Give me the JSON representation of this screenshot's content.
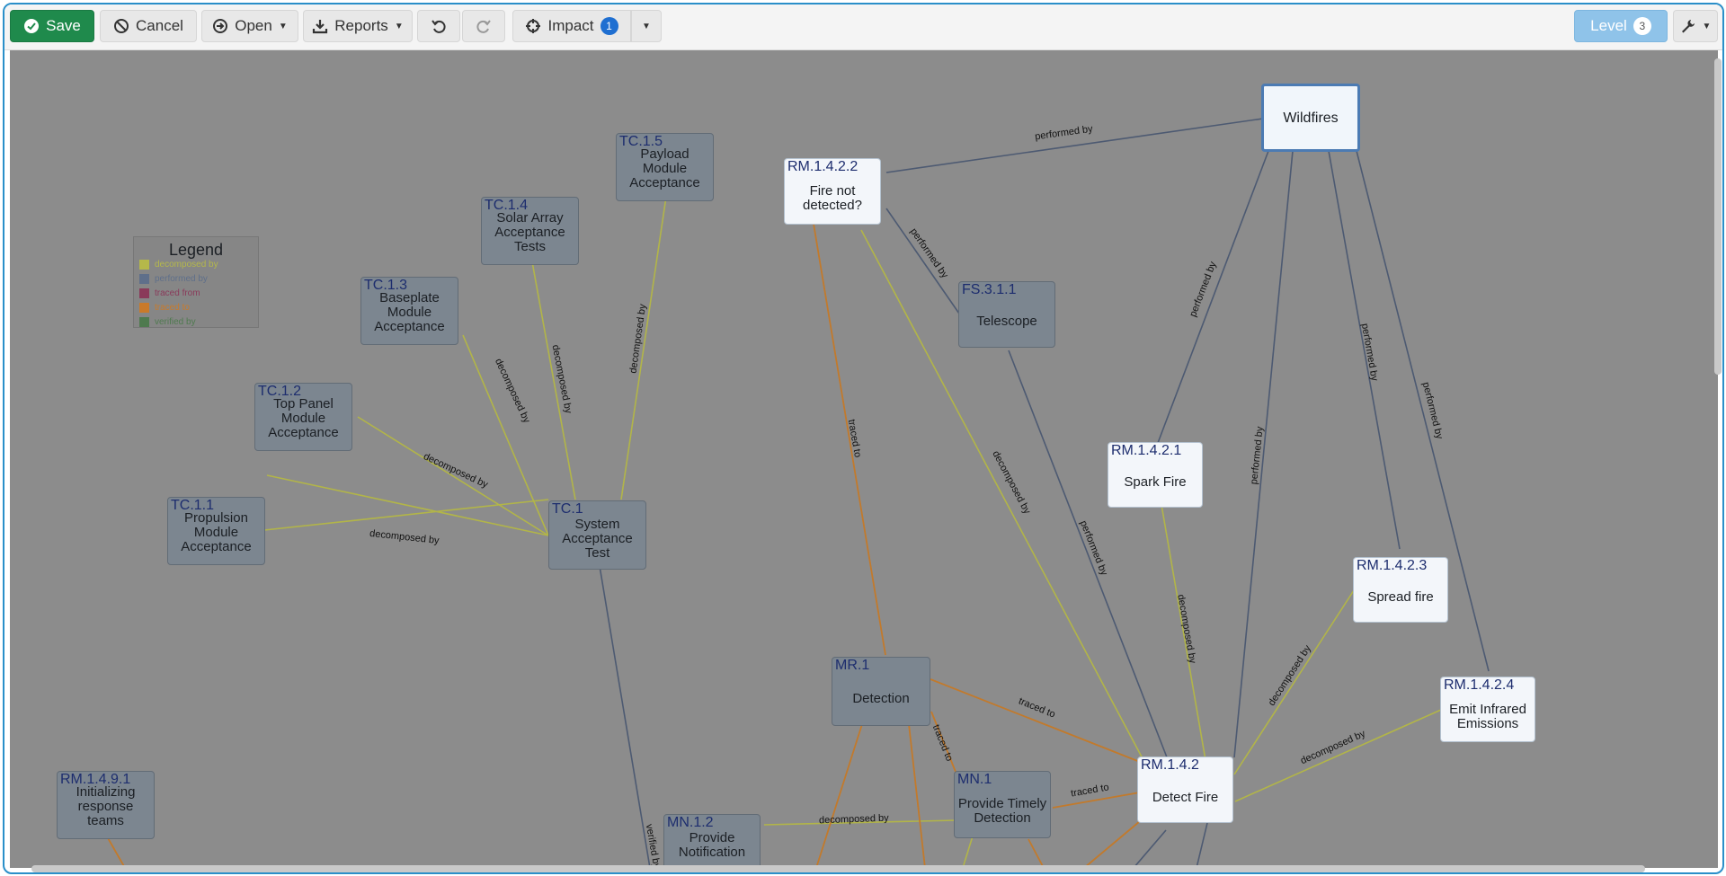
{
  "toolbar": {
    "save_label": "Save",
    "cancel_label": "Cancel",
    "open_label": "Open",
    "reports_label": "Reports",
    "impact_label": "Impact",
    "impact_count": "1",
    "level_label": "Level",
    "level_value": "3"
  },
  "legend": {
    "title": "Legend",
    "items": [
      {
        "label": "decomposed by",
        "color": "#b5b84a"
      },
      {
        "label": "performed by",
        "color": "#5f6f8a"
      },
      {
        "label": "traced from",
        "color": "#8a3a5a"
      },
      {
        "label": "traced to",
        "color": "#c97a2a"
      },
      {
        "label": "verified by",
        "color": "#4f7a4f"
      }
    ]
  },
  "nodes": {
    "wildfires": {
      "label": "Wildfires"
    },
    "rm1422": {
      "id": "RM.1.4.2.2",
      "label": "Fire not\ndetected?"
    },
    "fs311": {
      "id": "FS.3.1.1",
      "label": "Telescope"
    },
    "rm1421": {
      "id": "RM.1.4.2.1",
      "label": "Spark Fire"
    },
    "rm1423": {
      "id": "RM.1.4.2.3",
      "label": "Spread fire"
    },
    "rm1424": {
      "id": "RM.1.4.2.4",
      "label": "Emit Infrared\nEmissions"
    },
    "rm142": {
      "id": "RM.1.4.2",
      "label": "Detect Fire"
    },
    "mr1": {
      "id": "MR.1",
      "label": "Detection"
    },
    "mn1": {
      "id": "MN.1",
      "label": "Provide Timely\nDetection"
    },
    "mn12": {
      "id": "MN.1.2",
      "label": "Provide\nNotification"
    },
    "tc1": {
      "id": "TC.1",
      "label": "System\nAcceptance\nTest"
    },
    "tc11": {
      "id": "TC.1.1",
      "label": "Propulsion\nModule\nAcceptance"
    },
    "tc12": {
      "id": "TC.1.2",
      "label": "Top Panel\nModule\nAcceptance"
    },
    "tc13": {
      "id": "TC.1.3",
      "label": "Baseplate\nModule\nAcceptance"
    },
    "tc14": {
      "id": "TC.1.4",
      "label": "Solar Array\nAcceptance\nTests"
    },
    "tc15": {
      "id": "TC.1.5",
      "label": "Payload\nModule\nAcceptance"
    },
    "rm14912": {
      "id": "RM.1.4.9.1",
      "label": "Initializing\nresponse\nteams"
    }
  },
  "edges": {
    "performed_by": "performed by",
    "decomposed_by": "decomposed by",
    "traced_to": "traced to",
    "verified_by": "verified by"
  }
}
